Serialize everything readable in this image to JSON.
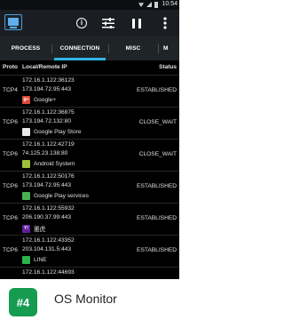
{
  "statusbar": {
    "time": "10:54"
  },
  "actionbar": {
    "icons": [
      "app-logo-icon",
      "info-icon",
      "filter-sliders-icon",
      "pause-icon",
      "overflow-menu-icon"
    ]
  },
  "tabs": [
    {
      "label": "PROCESS"
    },
    {
      "label": "CONNECTION",
      "selected": true
    },
    {
      "label": "MISC"
    },
    {
      "label": "M"
    }
  ],
  "table": {
    "headers": {
      "proto": "Proto",
      "address": "Local/Remote IP",
      "status": "Status"
    },
    "rows": [
      {
        "proto": "TCP4",
        "local": "172.16.1.122:36123",
        "remote": "173.194.72.95:443",
        "status": "ESTABLISHED",
        "app": "Google+",
        "icon_color": "#dd4b39",
        "icon_glyph": "g+"
      },
      {
        "proto": "TCP6",
        "local": "172.16.1.122:36875",
        "remote": "173.194.72.132:80",
        "status": "CLOSE_WAIT",
        "app": "Google Play Store",
        "icon_color": "#e9e9e9",
        "icon_glyph": ""
      },
      {
        "proto": "TCP6",
        "local": "172.16.1.122:42719",
        "remote": "74.125.23.138:80",
        "status": "CLOSE_WAIT",
        "app": "Android System",
        "icon_color": "#9fbf3b",
        "icon_glyph": ""
      },
      {
        "proto": "TCP6",
        "local": "172.16.1.122:50176",
        "remote": "173.194.72.95:443",
        "status": "ESTABLISHED",
        "app": "Google Play services",
        "icon_color": "#4caf50",
        "icon_glyph": ""
      },
      {
        "proto": "TCP6",
        "local": "172.16.1.122:55932",
        "remote": "206.190.37.99:443",
        "status": "ESTABLISHED",
        "app": "雅虎",
        "icon_color": "#5f1d9a",
        "icon_glyph": "Y!"
      },
      {
        "proto": "TCP6",
        "local": "172.16.1.122:43352",
        "remote": "203.104.131.5:443",
        "status": "ESTABLISHED",
        "app": "LINE",
        "icon_color": "#2bb24c",
        "icon_glyph": ""
      },
      {
        "proto": "TCP6",
        "local": "172.16.1.122:44693",
        "remote": "",
        "status": "",
        "app": "",
        "icon_color": "",
        "icon_glyph": ""
      }
    ]
  },
  "footer": {
    "rank": "#4",
    "app_name": "OS Monitor"
  }
}
